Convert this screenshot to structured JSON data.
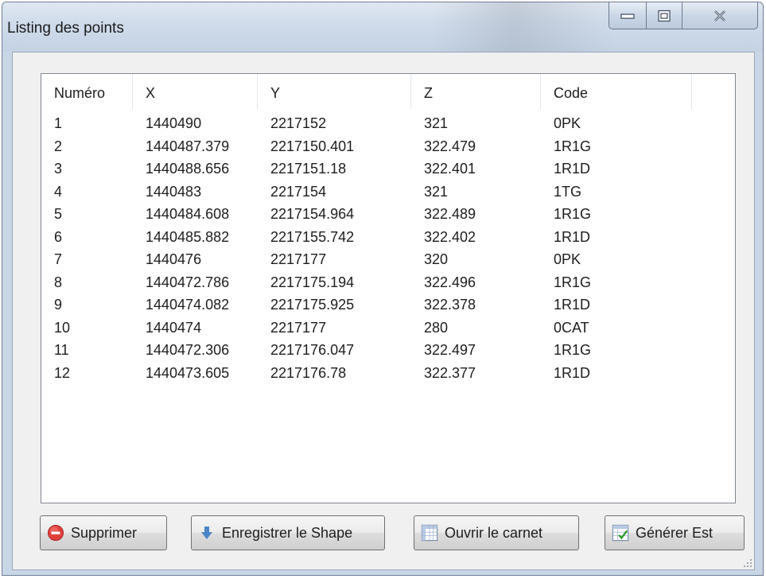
{
  "window": {
    "title": "Listing des points"
  },
  "table": {
    "columns": [
      "Numéro",
      "X",
      "Y",
      "Z",
      "Code"
    ],
    "rows": [
      [
        "1",
        "1440490",
        "2217152",
        "321",
        "0PK"
      ],
      [
        "2",
        "1440487.379",
        "2217150.401",
        "322.479",
        "1R1G"
      ],
      [
        "3",
        "1440488.656",
        "2217151.18",
        "322.401",
        "1R1D"
      ],
      [
        "4",
        "1440483",
        "2217154",
        "321",
        "1TG"
      ],
      [
        "5",
        "1440484.608",
        "2217154.964",
        "322.489",
        "1R1G"
      ],
      [
        "6",
        "1440485.882",
        "2217155.742",
        "322.402",
        "1R1D"
      ],
      [
        "7",
        "1440476",
        "2217177",
        "320",
        "0PK"
      ],
      [
        "8",
        "1440472.786",
        "2217175.194",
        "322.496",
        "1R1G"
      ],
      [
        "9",
        "1440474.082",
        "2217175.925",
        "322.378",
        "1R1D"
      ],
      [
        "10",
        "1440474",
        "2217177",
        "280",
        "0CAT"
      ],
      [
        "11",
        "1440472.306",
        "2217176.047",
        "322.497",
        "1R1G"
      ],
      [
        "12",
        "1440473.605",
        "2217176.78",
        "322.377",
        "1R1D"
      ]
    ]
  },
  "buttons": {
    "delete_label": "Supprimer",
    "save_shape_label": "Enregistrer le Shape",
    "open_notebook_label": "Ouvrir le carnet",
    "generate_label": "Générer Est"
  },
  "icons": {
    "delete": "delete-icon",
    "save": "down-arrow-icon",
    "notebook": "notebook-icon",
    "generate": "generate-icon"
  }
}
